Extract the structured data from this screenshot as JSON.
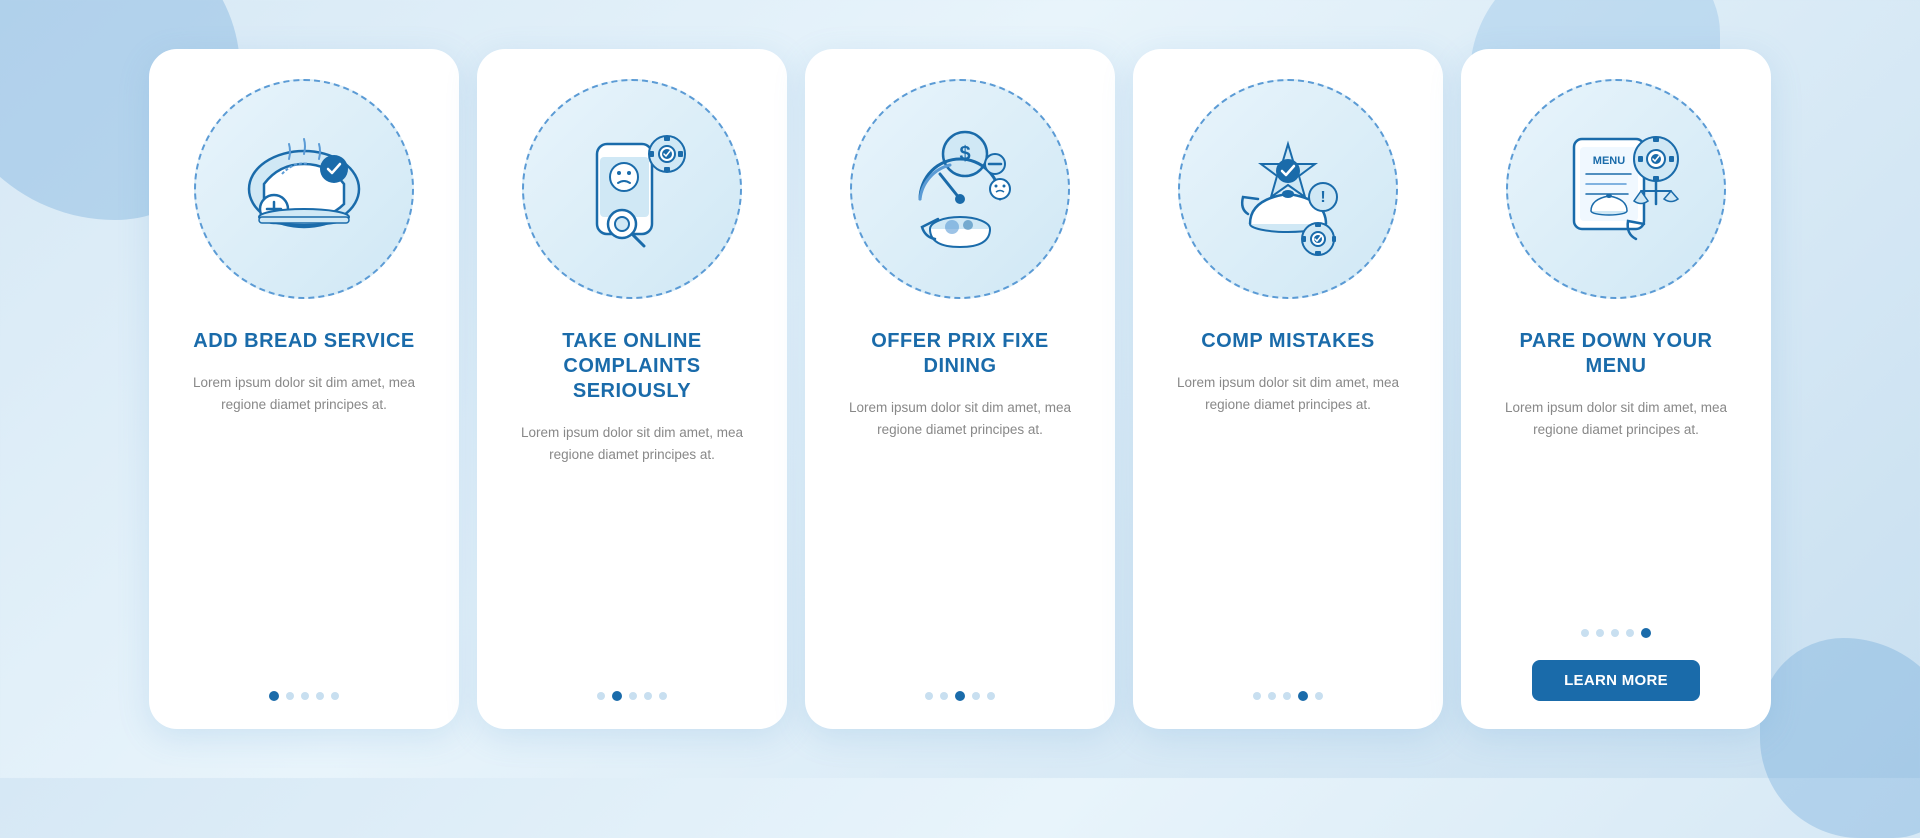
{
  "cards": [
    {
      "id": "card-1",
      "title": "ADD BREAD SERVICE",
      "description": "Lorem ipsum dolor sit dim amet, mea regione diamet principes at.",
      "dots": [
        true,
        false,
        false,
        false,
        false
      ],
      "hasButton": false,
      "buttonLabel": null
    },
    {
      "id": "card-2",
      "title": "TAKE ONLINE COMPLAINTS SERIOUSLY",
      "description": "Lorem ipsum dolor sit dim amet, mea regione diamet principes at.",
      "dots": [
        false,
        true,
        false,
        false,
        false
      ],
      "hasButton": false,
      "buttonLabel": null
    },
    {
      "id": "card-3",
      "title": "OFFER PRIX FIXE DINING",
      "description": "Lorem ipsum dolor sit dim amet, mea regione diamet principes at.",
      "dots": [
        false,
        false,
        true,
        false,
        false
      ],
      "hasButton": false,
      "buttonLabel": null
    },
    {
      "id": "card-4",
      "title": "COMP MISTAKES",
      "description": "Lorem ipsum dolor sit dim amet, mea regione diamet principes at.",
      "dots": [
        false,
        false,
        false,
        true,
        false
      ],
      "hasButton": false,
      "buttonLabel": null
    },
    {
      "id": "card-5",
      "title": "PARE DOWN YOUR MENU",
      "description": "Lorem ipsum dolor sit dim amet, mea regione diamet principes at.",
      "dots": [
        false,
        false,
        false,
        false,
        true
      ],
      "hasButton": true,
      "buttonLabel": "LEARN MORE"
    }
  ]
}
